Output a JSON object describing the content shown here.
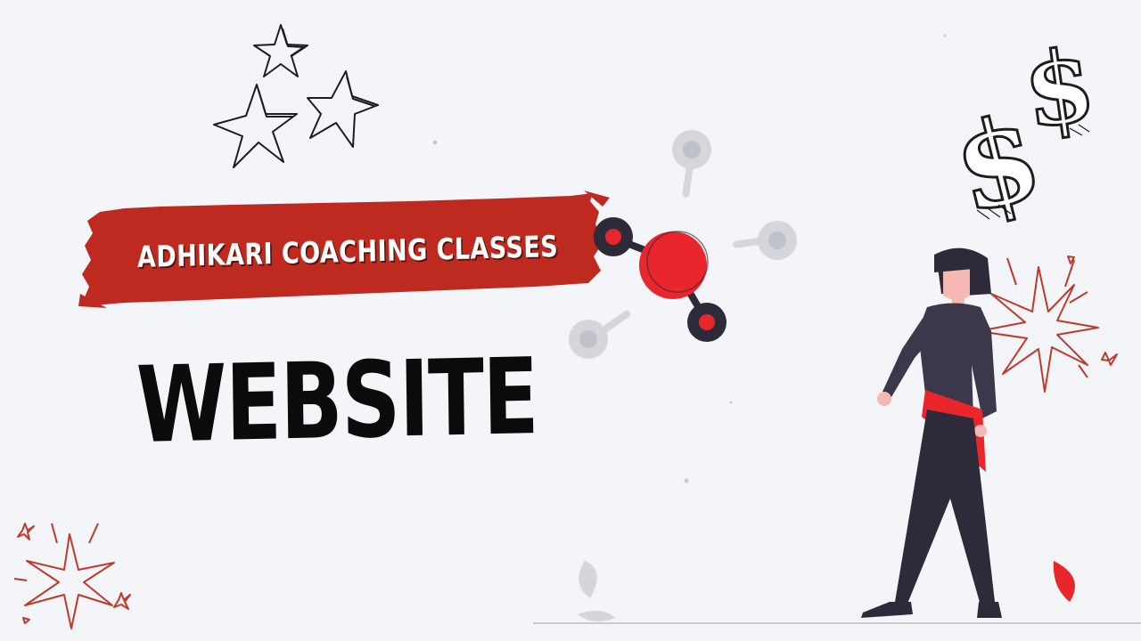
{
  "banner": {
    "text": "ADHIKARI COACHING CLASSES"
  },
  "headline": {
    "text": "WEBSITE"
  },
  "colors": {
    "background": "#f4f5f8",
    "accent_red": "#bf2a20",
    "bright_red": "#e8262b",
    "ink_dark": "#2d2b3a",
    "headline_black": "#0b0b0b"
  },
  "icons": [
    "star-icon",
    "dollar-sign-icon",
    "sparkle-burst-icon",
    "molecule-icon",
    "leaf-icon"
  ]
}
